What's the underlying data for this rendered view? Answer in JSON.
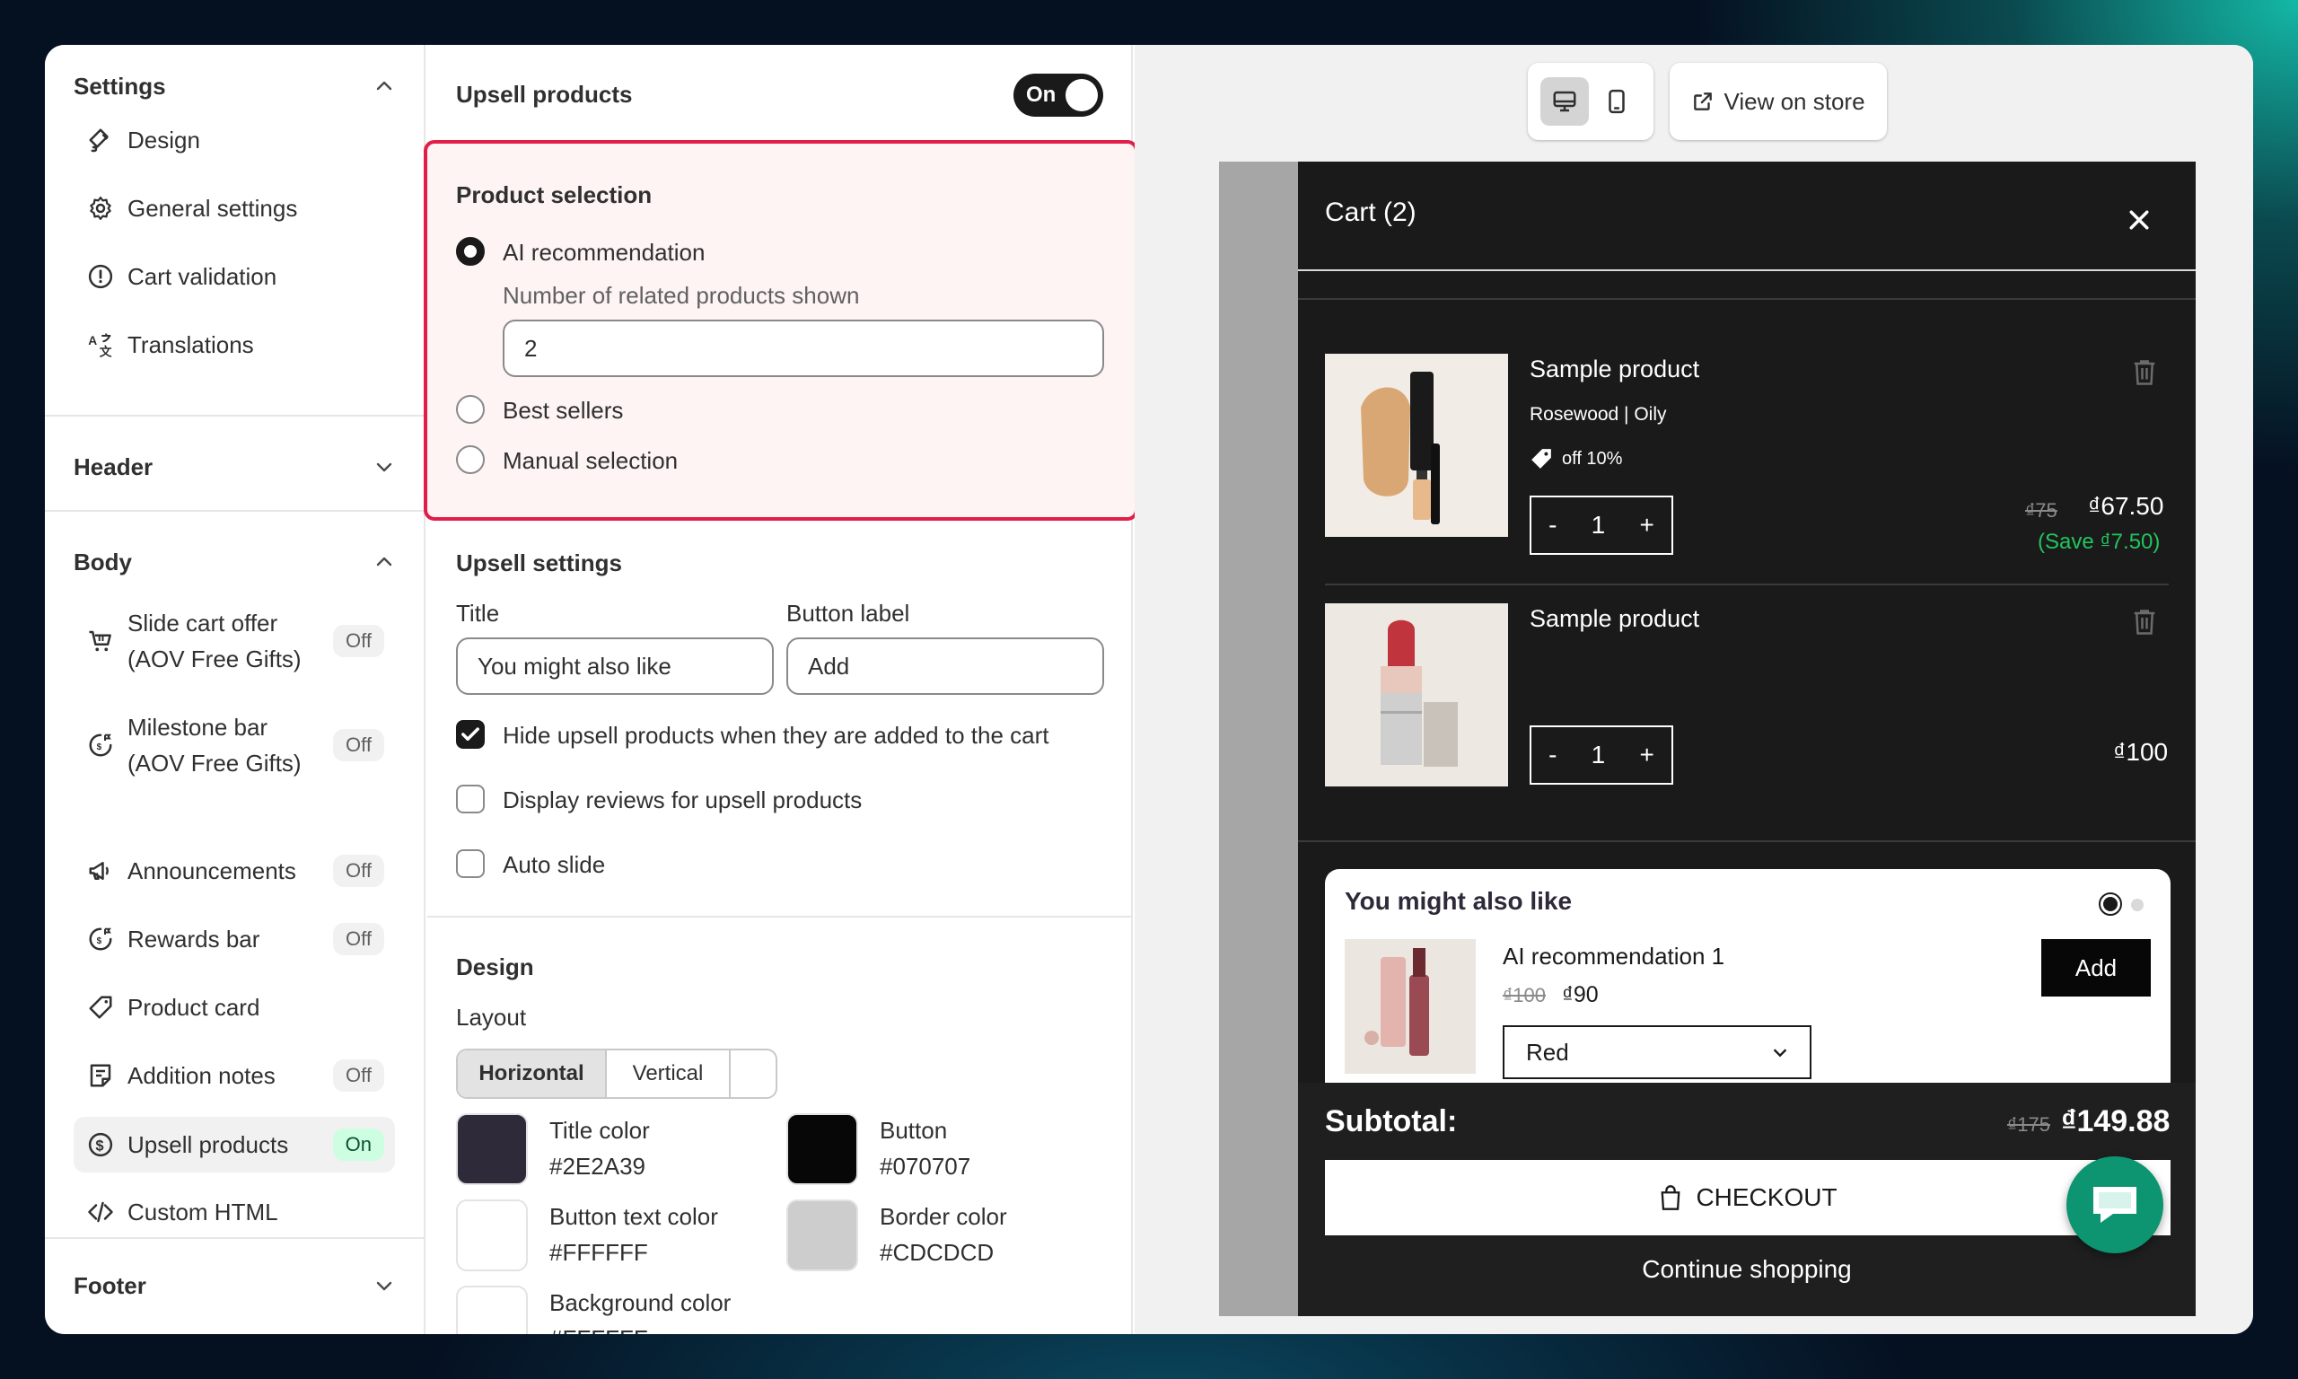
{
  "sidebar": {
    "settings": {
      "title": "Settings",
      "items": [
        {
          "label": "Design",
          "icon": "design-icon"
        },
        {
          "label": "General settings",
          "icon": "gear-icon"
        },
        {
          "label": "Cart validation",
          "icon": "alert-icon"
        },
        {
          "label": "Translations",
          "icon": "translate-icon"
        }
      ]
    },
    "header": {
      "title": "Header"
    },
    "body": {
      "title": "Body",
      "items": [
        {
          "label": "Slide cart offer\n(AOV Free Gifts)",
          "status": "Off",
          "icon": "cart-gift-icon"
        },
        {
          "label": "Milestone bar\n(AOV Free Gifts)",
          "status": "Off",
          "icon": "milestone-icon"
        },
        {
          "label": "Announcements",
          "status": "Off",
          "icon": "megaphone-icon"
        },
        {
          "label": "Rewards bar",
          "status": "Off",
          "icon": "rewards-icon"
        },
        {
          "label": "Product card",
          "status": "",
          "icon": "tag-icon"
        },
        {
          "label": "Addition notes",
          "status": "Off",
          "icon": "note-icon"
        },
        {
          "label": "Upsell products",
          "status": "On",
          "icon": "dollar-icon"
        },
        {
          "label": "Custom HTML",
          "status": "",
          "icon": "code-icon"
        }
      ]
    },
    "footer": {
      "title": "Footer"
    }
  },
  "panel": {
    "title": "Upsell products",
    "toggle": "On",
    "selection": {
      "title": "Product selection",
      "options": [
        "AI recommendation",
        "Best sellers",
        "Manual selection"
      ],
      "selected": "AI recommendation",
      "count_label": "Number of related products shown",
      "count_value": "2"
    },
    "upsell_settings": {
      "title": "Upsell settings",
      "title_label": "Title",
      "title_value": "You might also like",
      "button_label": "Button label",
      "button_value": "Add",
      "checks": [
        {
          "label": "Hide upsell products when they are added to the cart",
          "checked": true
        },
        {
          "label": "Display reviews for upsell products",
          "checked": false
        },
        {
          "label": "Auto slide",
          "checked": false
        }
      ]
    },
    "design": {
      "title": "Design",
      "layout_label": "Layout",
      "layout_options": [
        "Horizontal",
        "Vertical"
      ],
      "layout_selected": "Horizontal",
      "colors": [
        {
          "label": "Title color",
          "value": "#2E2A39"
        },
        {
          "label": "Button",
          "value": "#070707"
        },
        {
          "label": "Button text color",
          "value": "#FFFFFF"
        },
        {
          "label": "Border color",
          "value": "#CDCDCD"
        },
        {
          "label": "Background color",
          "value": "#FFFFFF"
        }
      ]
    }
  },
  "preview": {
    "view_on_store": "View on store",
    "cart": {
      "title": "Cart (2)",
      "items": [
        {
          "name": "Sample product",
          "variant": "Rosewood | Oily",
          "discount": "off 10%",
          "qty": "1",
          "old_price": "₫75",
          "price": "₫67.50",
          "save": "(Save ₫7.50)"
        },
        {
          "name": "Sample product",
          "variant": "",
          "discount": "",
          "qty": "1",
          "old_price": "",
          "price": "₫100",
          "save": ""
        }
      ],
      "upsell": {
        "title": "You might also like",
        "product": "AI recommendation 1",
        "old_price": "₫100",
        "price": "₫90",
        "variant": "Red",
        "button": "Add"
      },
      "subtotal_label": "Subtotal:",
      "subtotal_old": "₫175",
      "subtotal": "₫149.88",
      "checkout": "CHECKOUT",
      "continue": "Continue shopping"
    }
  },
  "colors": {
    "accent_red": "#E11D48",
    "save_green": "#22C55E",
    "chat_green": "#0D9470"
  }
}
